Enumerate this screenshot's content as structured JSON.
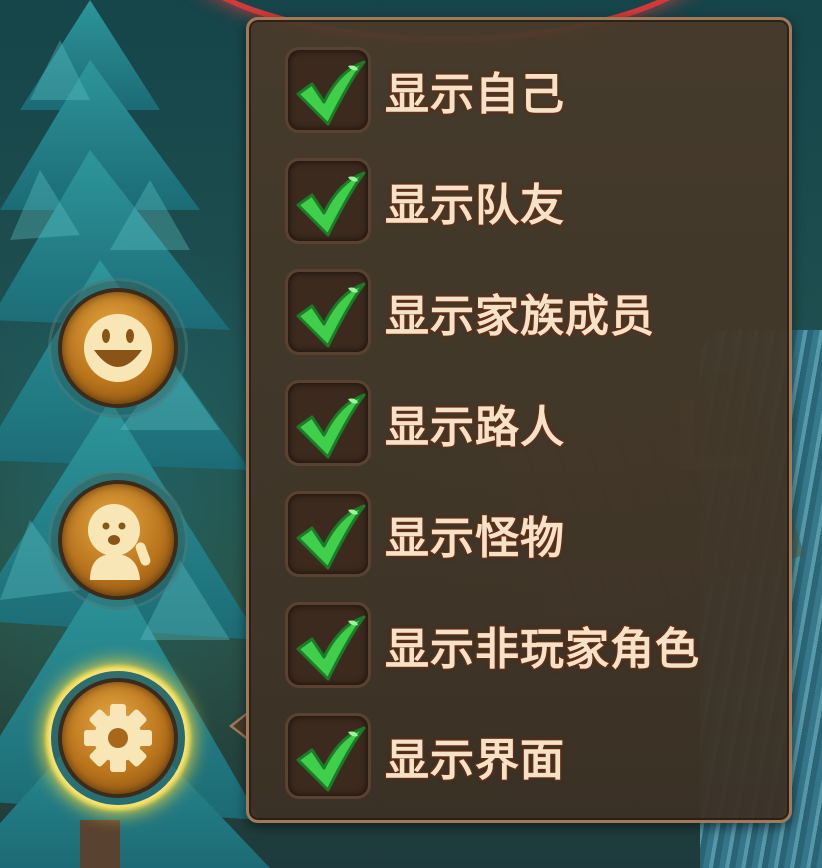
{
  "menu": {
    "options": [
      {
        "label": "显示自己",
        "checked": true
      },
      {
        "label": "显示队友",
        "checked": true
      },
      {
        "label": "显示家族成员",
        "checked": true
      },
      {
        "label": "显示路人",
        "checked": true
      },
      {
        "label": "显示怪物",
        "checked": true
      },
      {
        "label": "显示非玩家角色",
        "checked": true
      },
      {
        "label": "显示界面",
        "checked": true
      }
    ]
  },
  "side_buttons": [
    {
      "icon": "smiley-face-icon",
      "active": false
    },
    {
      "icon": "character-waving-icon",
      "active": false
    },
    {
      "icon": "gear-icon",
      "active": true
    }
  ],
  "colors": {
    "menu_bg": "#483a2a",
    "menu_border": "#a07a5a",
    "check_green": "#3fcf4a",
    "label_text": "#f6e2c8",
    "button_gold": "#c98a2a",
    "active_glow": "#ffdc3c"
  }
}
